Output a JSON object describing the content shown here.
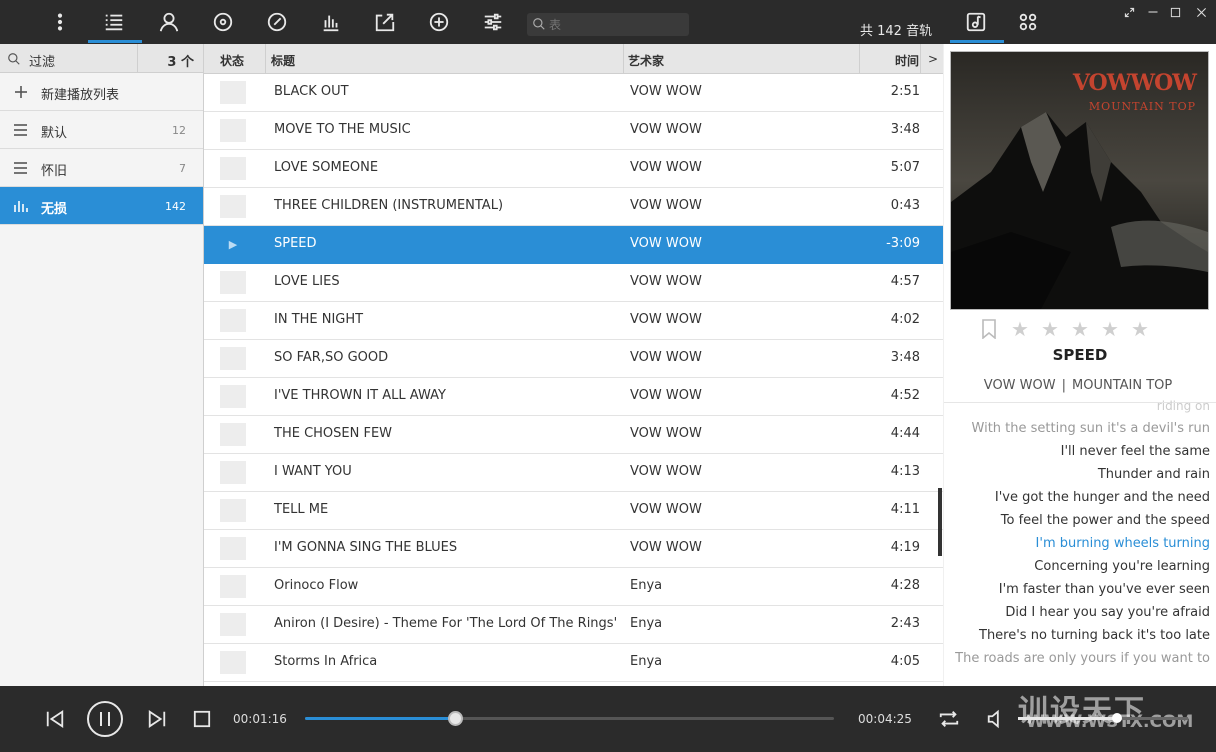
{
  "toolbar": {
    "search_placeholder": "表",
    "track_count": "共 142 音轨",
    "icons": [
      "more-icon",
      "playlist-icon",
      "artist-icon",
      "album-icon",
      "genre-icon",
      "equalizer-icon",
      "share-icon",
      "add-icon",
      "settings-icon",
      "search-icon",
      "music-note-icon",
      "apps-icon"
    ]
  },
  "sidebar": {
    "filter_label": "过滤",
    "filter_count": "3 个",
    "new_playlist": "新建播放列表",
    "items": [
      {
        "label": "默认",
        "count": "12",
        "icon": "list-icon"
      },
      {
        "label": "怀旧",
        "count": "7",
        "icon": "list-icon"
      },
      {
        "label": "无损",
        "count": "142",
        "icon": "bars-icon",
        "active": true
      }
    ]
  },
  "tracklist": {
    "headers": {
      "status": "状态",
      "title": "标题",
      "artist": "艺术家",
      "time": "时间",
      "more": ">"
    },
    "rows": [
      {
        "title": "BLACK OUT",
        "artist": "VOW WOW",
        "time": "2:51"
      },
      {
        "title": "MOVE TO THE MUSIC",
        "artist": "VOW WOW",
        "time": "3:48"
      },
      {
        "title": "LOVE SOMEONE",
        "artist": "VOW WOW",
        "time": "5:07"
      },
      {
        "title": "THREE CHILDREN (INSTRUMENTAL)",
        "artist": "VOW WOW",
        "time": "0:43"
      },
      {
        "title": "SPEED",
        "artist": "VOW WOW",
        "time": "-3:09",
        "playing": true
      },
      {
        "title": "LOVE LIES",
        "artist": "VOW WOW",
        "time": "4:57"
      },
      {
        "title": "IN THE NIGHT",
        "artist": "VOW WOW",
        "time": "4:02"
      },
      {
        "title": "SO FAR,SO GOOD",
        "artist": "VOW WOW",
        "time": "3:48"
      },
      {
        "title": "I'VE THROWN IT ALL AWAY",
        "artist": "VOW WOW",
        "time": "4:52"
      },
      {
        "title": "THE CHOSEN FEW",
        "artist": "VOW WOW",
        "time": "4:44"
      },
      {
        "title": "I WANT YOU",
        "artist": "VOW WOW",
        "time": "4:13"
      },
      {
        "title": "TELL ME",
        "artist": "VOW WOW",
        "time": "4:11"
      },
      {
        "title": "I'M GONNA SING THE BLUES",
        "artist": "VOW WOW",
        "time": "4:19"
      },
      {
        "title": "Orinoco Flow",
        "artist": "Enya",
        "time": "4:28"
      },
      {
        "title": "Aniron (I Desire) - Theme For 'The Lord Of The Rings'",
        "artist": "Enya",
        "time": "2:43"
      },
      {
        "title": "Storms In Africa",
        "artist": "Enya",
        "time": "4:05"
      }
    ]
  },
  "nowplaying": {
    "cover_band": "VOWWOW",
    "cover_album": "MOUNTAIN TOP",
    "title": "SPEED",
    "artist": "VOW WOW",
    "album": "MOUNTAIN TOP",
    "rating_stars": 0,
    "lyrics": [
      {
        "text": "riding on",
        "style": "fade1"
      },
      {
        "text": "With the setting sun it's a devil's run",
        "style": "fade2"
      },
      {
        "text": "I'll never feel the same",
        "style": ""
      },
      {
        "text": "Thunder and rain",
        "style": ""
      },
      {
        "text": "I've got the hunger and the need",
        "style": ""
      },
      {
        "text": "To feel the power and the speed",
        "style": ""
      },
      {
        "text": "I'm burning wheels turning",
        "style": "cur"
      },
      {
        "text": "Concerning you're learning",
        "style": ""
      },
      {
        "text": "I'm faster than you've ever seen",
        "style": ""
      },
      {
        "text": "Did I hear you say you're afraid",
        "style": ""
      },
      {
        "text": "There's no turning back it's too late",
        "style": ""
      },
      {
        "text": "The roads are only yours if you want to",
        "style": "fade2"
      }
    ]
  },
  "player": {
    "elapsed": "00:01:16",
    "total": "00:04:25",
    "progress": 0.283,
    "volume": 0.58,
    "accent": "#2a8ed6"
  },
  "watermark": {
    "cn": "训设天下",
    "url": "WWW.WSTX.COM"
  }
}
